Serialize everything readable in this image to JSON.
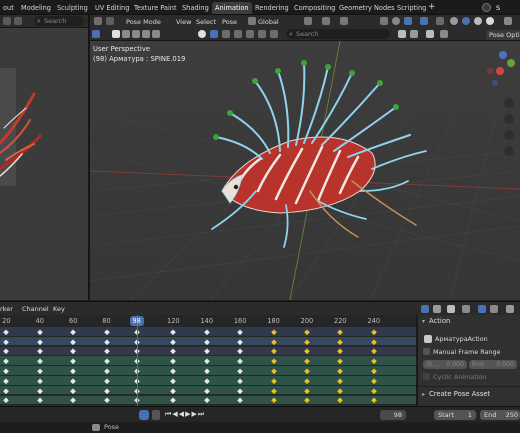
{
  "workspace_tabs": [
    "out",
    "Modeling",
    "Sculpting",
    "UV Editing",
    "Texture Paint",
    "Shading",
    "Animation",
    "Rendering",
    "Compositing",
    "Geometry Nodes",
    "Scripting"
  ],
  "active_tab": "Animation",
  "scene_label": "S",
  "left_viewport": {
    "search_placeholder": "Search"
  },
  "viewport_header": {
    "mode": "Pose Mode",
    "menu_view": "View",
    "menu_select": "Select",
    "menu_pose": "Pose",
    "orientation": "Global",
    "search_placeholder": "Search",
    "pose_options": "Pose Option"
  },
  "viewport_overlay": {
    "perspective": "User Perspective",
    "active_object": "(98) Арматура : SPINE.019"
  },
  "dopesheet_header": {
    "menu_marker": "rker",
    "menu_channel": "Channel",
    "menu_key": "Key"
  },
  "ruler": {
    "labels": [
      "20",
      "40",
      "60",
      "80",
      "98",
      "120",
      "140",
      "160",
      "180",
      "200",
      "220",
      "240"
    ],
    "current_frame": 98
  },
  "keyframes": {
    "frames": [
      20,
      40,
      60,
      80,
      98,
      120,
      140,
      160,
      180,
      200,
      220,
      240
    ],
    "selected_from": 180,
    "row_count": 8
  },
  "action_panel": {
    "title": "Action",
    "action_name": "АрматураAction",
    "manual_frame_range": "Manual Frame Range",
    "start_label": "St...",
    "start_value": "0.000",
    "end_label": "End",
    "end_value": "0.000",
    "cyclic": "Cyclic Animation",
    "create_pose": "Create Pose Asset"
  },
  "playback": {
    "current_frame": "98",
    "start_label": "Start",
    "start_value": "1",
    "end_label": "End",
    "end_value": "250"
  },
  "status": {
    "mode_text": "Pose"
  },
  "colors": {
    "active_tab": "#3d3d3d",
    "accent": "#4772b3",
    "frame_indicator": "#4772b3",
    "selected_key": "#f0c020"
  }
}
